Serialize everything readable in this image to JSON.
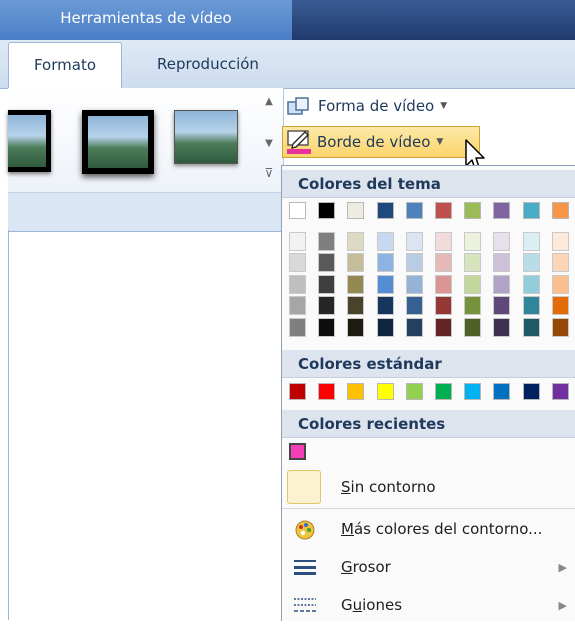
{
  "header": {
    "tools_title": "Herramientas de vídeo"
  },
  "tabs": [
    {
      "label": "Formato",
      "active": true
    },
    {
      "label": "Reproducción",
      "active": false
    }
  ],
  "commands": {
    "video_shape": "Forma de vídeo",
    "video_border": "Borde de vídeo",
    "border_color": "#e8319a"
  },
  "dropdown": {
    "theme_colors_title": "Colores del tema",
    "theme_colors": [
      [
        "#ffffff",
        "#f2f2f2",
        "#d9d9d9",
        "#bfbfbf",
        "#a6a6a6",
        "#7f7f7f"
      ],
      [
        "#000000",
        "#7f7f7f",
        "#595959",
        "#3f3f3f",
        "#262626",
        "#0d0d0d"
      ],
      [
        "#eeece1",
        "#ddd9c3",
        "#c4bd97",
        "#938953",
        "#494429",
        "#1d1b10"
      ],
      [
        "#1f497d",
        "#c6d9f0",
        "#8db3e2",
        "#548dd4",
        "#17365d",
        "#0f243e"
      ],
      [
        "#4f81bd",
        "#dbe5f1",
        "#b8cce4",
        "#95b3d7",
        "#366092",
        "#244061"
      ],
      [
        "#c0504d",
        "#f2dcdb",
        "#e5b9b7",
        "#d99694",
        "#953734",
        "#632423"
      ],
      [
        "#9bbb59",
        "#ebf1dd",
        "#d7e3bc",
        "#c3d69b",
        "#76923c",
        "#4f6128"
      ],
      [
        "#8064a2",
        "#e5e0ec",
        "#ccc1d9",
        "#b2a2c7",
        "#5f497a",
        "#3f3151"
      ],
      [
        "#4bacc6",
        "#dbeef3",
        "#b7dde8",
        "#92cddc",
        "#31859b",
        "#205867"
      ],
      [
        "#f79646",
        "#fdeada",
        "#fbd5b5",
        "#fac08f",
        "#e36c09",
        "#974806"
      ]
    ],
    "standard_colors_title": "Colores estándar",
    "standard_colors": [
      "#c00000",
      "#ff0000",
      "#ffc000",
      "#ffff00",
      "#92d050",
      "#00b050",
      "#00b0f0",
      "#0070c0",
      "#002060",
      "#7030a0"
    ],
    "recent_colors_title": "Colores recientes",
    "recent_colors": [
      "#f23fb8"
    ],
    "no_outline": "Sin contorno",
    "more_colors": "Más colores del contorno...",
    "weight": "Grosor",
    "dashes": "Guiones"
  }
}
